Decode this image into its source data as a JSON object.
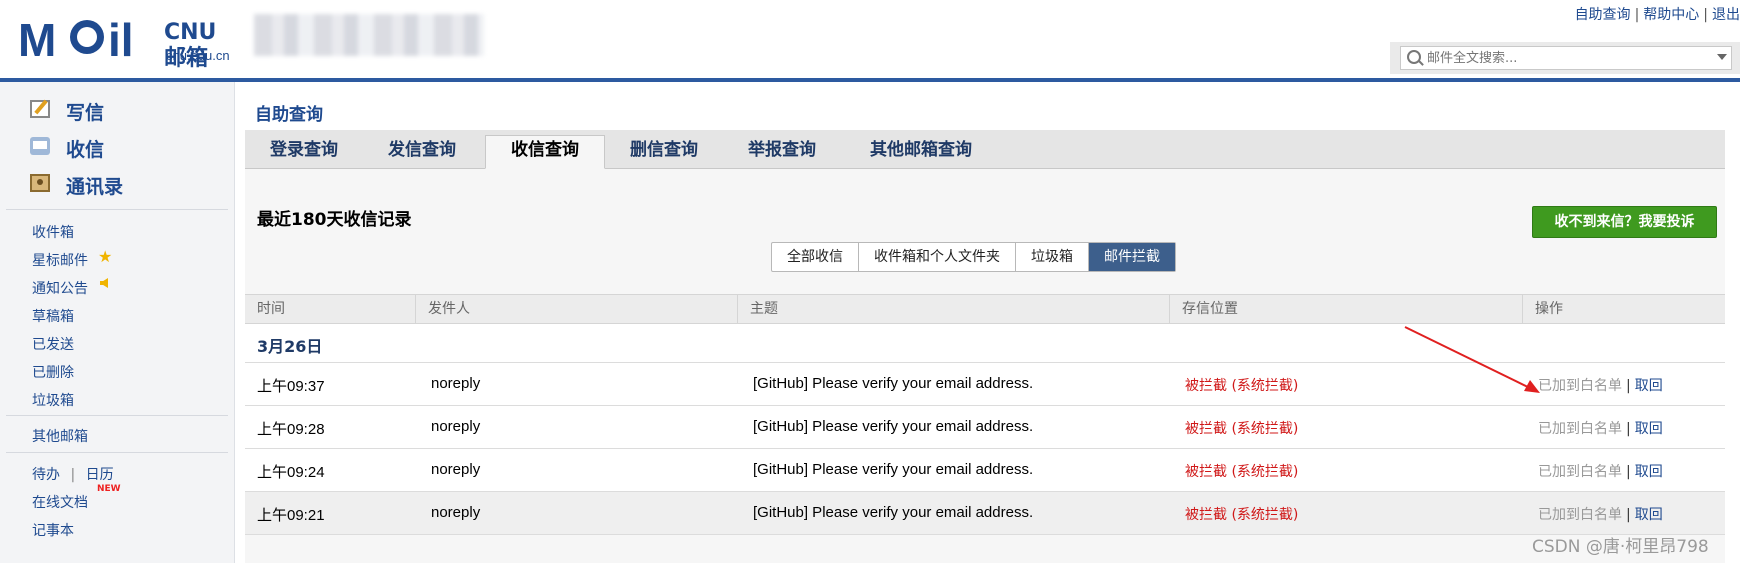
{
  "logo": {
    "main_text": "MOil",
    "cn_text": "CNU邮箱",
    "sub_text": "cnu.edu.cn"
  },
  "top_links": [
    "自助查询",
    "帮助中心",
    "退出"
  ],
  "search": {
    "placeholder": "邮件全文搜索..."
  },
  "sidebar": {
    "main_nav": [
      {
        "label": "写信",
        "icon": "compose-icon"
      },
      {
        "label": "收信",
        "icon": "inbox-icon"
      },
      {
        "label": "通讯录",
        "icon": "address-book-icon"
      }
    ],
    "folders": [
      "收件箱",
      "星标邮件",
      "通知公告",
      "草稿箱",
      "已发送",
      "已删除",
      "垃圾箱"
    ],
    "other_mail": "其他邮箱",
    "tools": {
      "todo": "待办",
      "calendar": "日历",
      "docs": "在线文档",
      "docs_badge": "NEW",
      "notes": "记事本"
    }
  },
  "page_title": "自助查询",
  "tabs": [
    "登录查询",
    "发信查询",
    "收信查询",
    "删信查询",
    "举报查询",
    "其他邮箱查询"
  ],
  "active_tab": "收信查询",
  "section_title": "最近180天收信记录",
  "complain_button": "收不到来信？我要投诉",
  "filters": [
    "全部收信",
    "收件箱和个人文件夹",
    "垃圾箱",
    "邮件拦截"
  ],
  "active_filter": "邮件拦截",
  "table": {
    "headers": [
      "时间",
      "发件人",
      "主题",
      "存信位置",
      "操作"
    ],
    "date_group": "3月26日",
    "rows": [
      {
        "time": "上午09:37",
        "sender": "noreply",
        "subject": "[GitHub] Please verify your email address.",
        "location": "被拦截 (系统拦截)",
        "op_added": "已加到白名单",
        "op_retrieve": "取回"
      },
      {
        "time": "上午09:28",
        "sender": "noreply",
        "subject": "[GitHub] Please verify your email address.",
        "location": "被拦截 (系统拦截)",
        "op_added": "已加到白名单",
        "op_retrieve": "取回"
      },
      {
        "time": "上午09:24",
        "sender": "noreply",
        "subject": "[GitHub] Please verify your email address.",
        "location": "被拦截 (系统拦截)",
        "op_added": "已加到白名单",
        "op_retrieve": "取回"
      },
      {
        "time": "上午09:21",
        "sender": "noreply",
        "subject": "[GitHub] Please verify your email address.",
        "location": "被拦截 (系统拦截)",
        "op_added": "已加到白名单",
        "op_retrieve": "取回"
      }
    ]
  },
  "watermark": "CSDN @唐·柯里昂798",
  "colors": {
    "brand": "#1f4a8f",
    "header_bar": "#2d5aa0",
    "blocked_red": "#d01818",
    "complain_green": "#3f9a1f",
    "annotation_arrow": "#e02020"
  }
}
